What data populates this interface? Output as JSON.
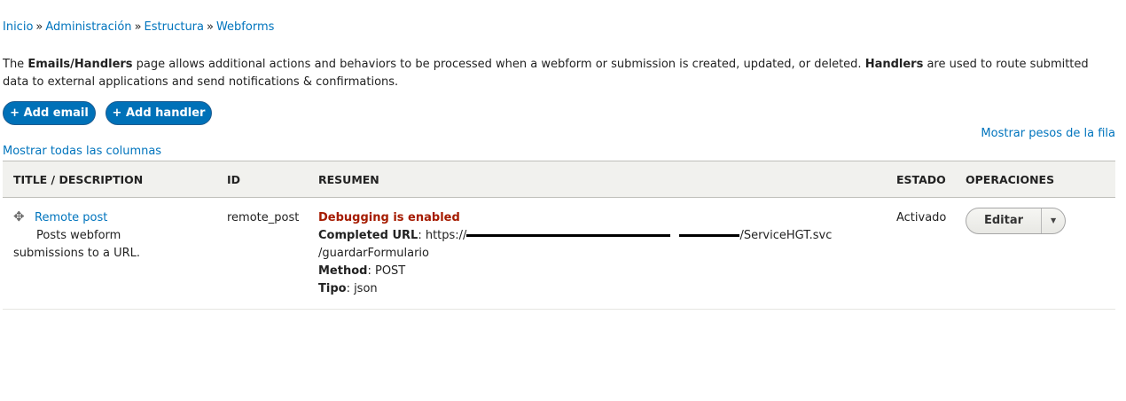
{
  "breadcrumb": {
    "items": [
      "Inicio",
      "Administración",
      "Estructura",
      "Webforms"
    ],
    "separator": "»"
  },
  "intro": {
    "p1": "The ",
    "b1": "Emails/Handlers",
    "p2": " page allows additional actions and behaviors to be processed when a webform or submission is created, updated, or deleted. ",
    "b2": "Handlers",
    "p3": " are used to route submitted data to external applications and send notifications & confirmations."
  },
  "actions": {
    "add_email": "+ Add email",
    "add_handler": "+ Add handler"
  },
  "links": {
    "show_weights": "Mostrar pesos de la fila",
    "show_columns": "Mostrar todas las columnas"
  },
  "table": {
    "headers": [
      "TITLE / DESCRIPTION",
      "ID",
      "RESUMEN",
      "ESTADO",
      "OPERACIONES"
    ],
    "row": {
      "title": "Remote post",
      "description": "Posts webform submissions to a URL.",
      "id": "remote_post",
      "debug": "Debugging is enabled",
      "completed_label": "Completed URL",
      "completed_prefix": ": https://",
      "completed_suffix": "/ServiceHGT.svc",
      "completed_path": "/guardarFormulario",
      "method_label": "Method",
      "method_value": ": POST",
      "tipo_label": "Tipo",
      "tipo_value": ": json",
      "status": "Activado",
      "edit": "Editar"
    }
  },
  "icons": {
    "drag": "move-arrows-icon",
    "dropdown": "caret-down-icon"
  },
  "colors": {
    "link": "#0074bd",
    "button": "#0071b8",
    "debug": "#a51b00",
    "header_bg": "#f1f1ee"
  }
}
